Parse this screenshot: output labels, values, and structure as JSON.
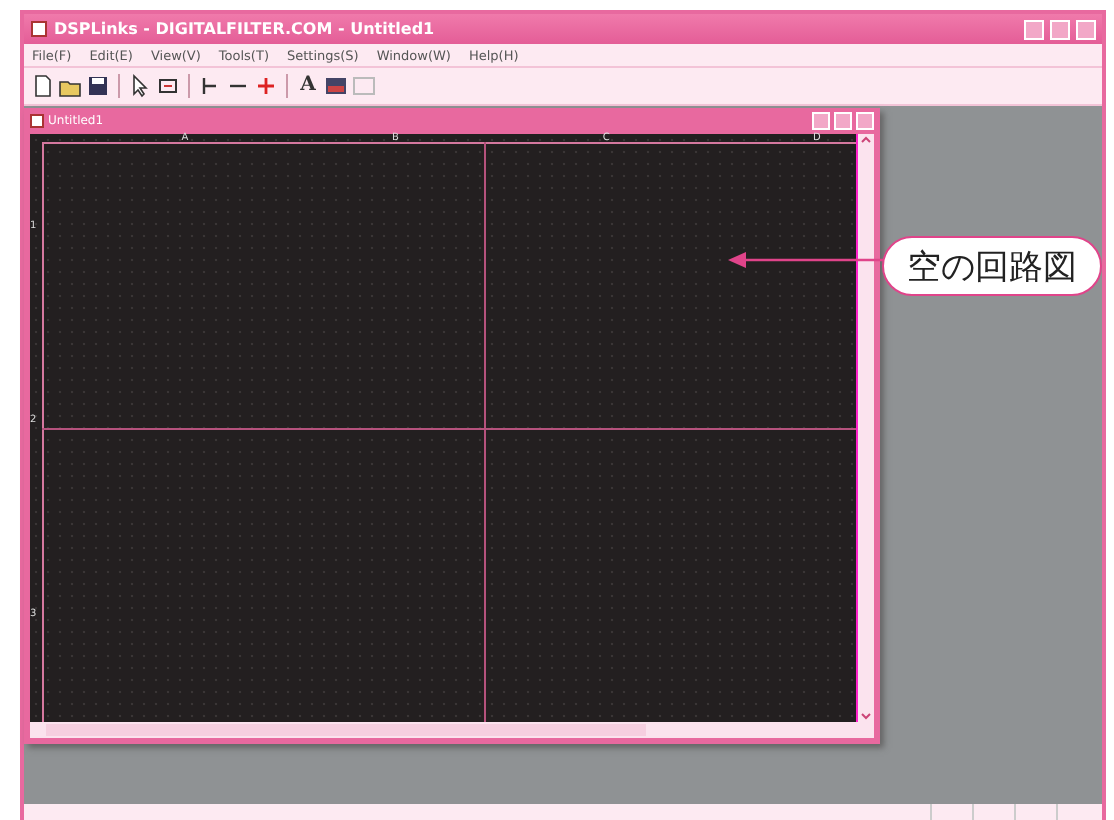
{
  "window": {
    "title": "DSPLinks - DIGITALFILTER.COM - Untitled1"
  },
  "menu": [
    "File(F)",
    "Edit(E)",
    "View(V)",
    "Tools(T)",
    "Settings(S)",
    "Window(W)",
    "Help(H)"
  ],
  "toolbar": {
    "text_tool": "A"
  },
  "document": {
    "title": "Untitled1",
    "columns": [
      "A",
      "B",
      "C",
      "D"
    ],
    "rows": [
      "1",
      "2",
      "3"
    ]
  },
  "callout": {
    "text": "空の回路図"
  }
}
